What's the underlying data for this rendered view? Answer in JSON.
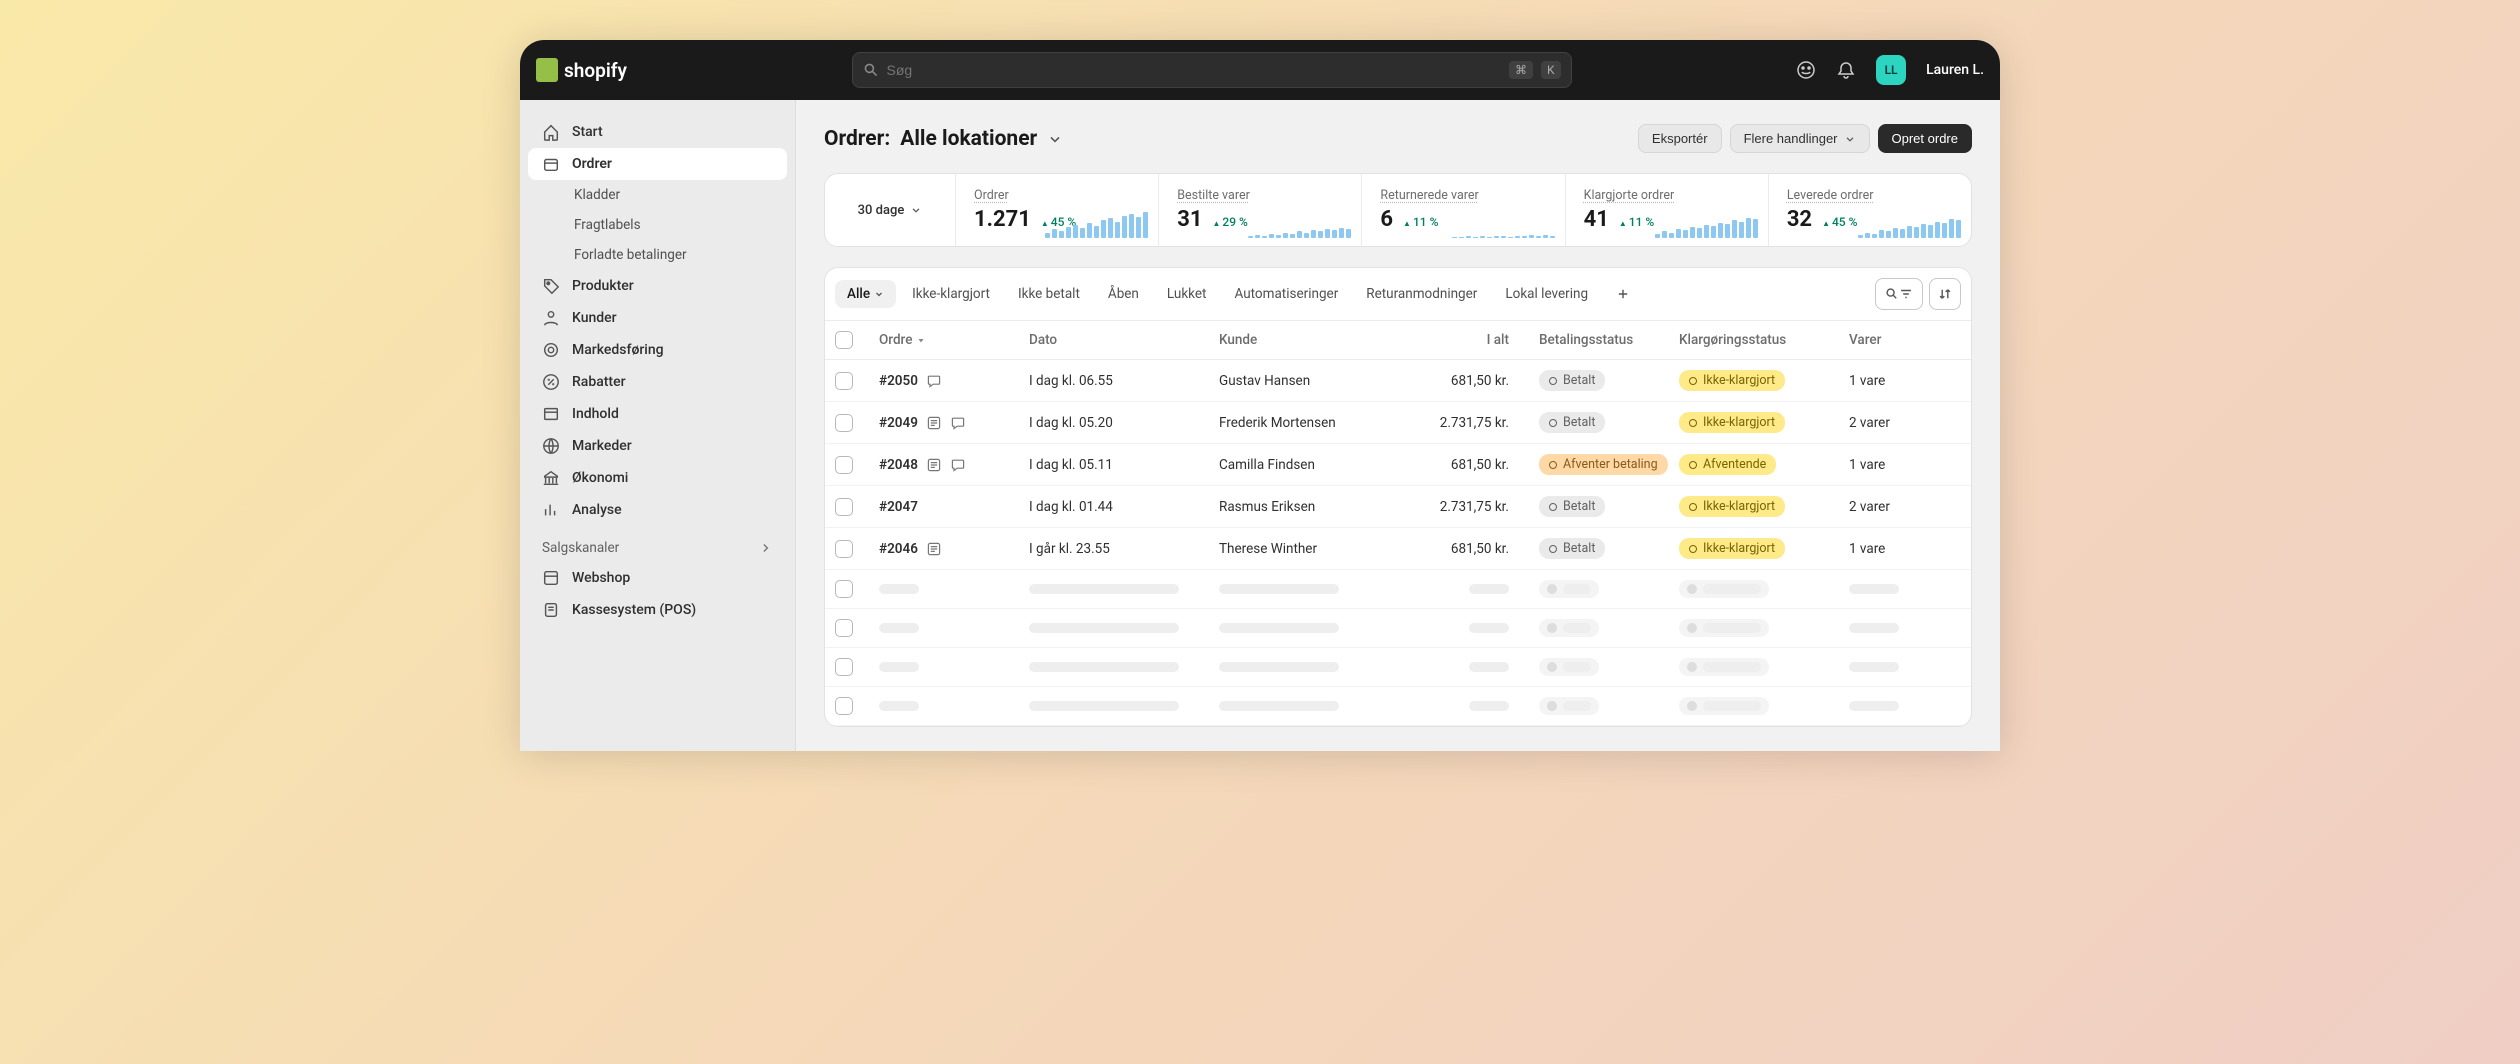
{
  "header": {
    "brand": "shopify",
    "search_placeholder": "Søg",
    "kbd1": "⌘",
    "kbd2": "K",
    "user_initials": "LL",
    "user_name": "Lauren L."
  },
  "sidebar": {
    "items": [
      {
        "label": "Start",
        "icon": "home"
      },
      {
        "label": "Ordrer",
        "icon": "orders",
        "active": true
      },
      {
        "label": "Kladder",
        "sub": true
      },
      {
        "label": "Fragtlabels",
        "sub": true
      },
      {
        "label": "Forladte betalinger",
        "sub": true
      },
      {
        "label": "Produkter",
        "icon": "tag"
      },
      {
        "label": "Kunder",
        "icon": "person"
      },
      {
        "label": "Markedsføring",
        "icon": "target"
      },
      {
        "label": "Rabatter",
        "icon": "discount"
      },
      {
        "label": "Indhold",
        "icon": "content"
      },
      {
        "label": "Markeder",
        "icon": "globe"
      },
      {
        "label": "Økonomi",
        "icon": "bank"
      },
      {
        "label": "Analyse",
        "icon": "analytics"
      }
    ],
    "section_label": "Salgskanaler",
    "channels": [
      {
        "label": "Webshop"
      },
      {
        "label": "Kassesystem (POS)"
      }
    ]
  },
  "page": {
    "title_prefix": "Ordrer:",
    "title_location": "Alle lokationer",
    "actions": {
      "export": "Eksportér",
      "more": "Flere handlinger",
      "create": "Opret ordre"
    }
  },
  "stats": {
    "range": "30 dage",
    "cards": [
      {
        "label": "Ordrer",
        "value": "1.271",
        "delta": "45 %"
      },
      {
        "label": "Bestilte varer",
        "value": "31",
        "delta": "29 %"
      },
      {
        "label": "Returnerede varer",
        "value": "6",
        "delta": "11 %"
      },
      {
        "label": "Klargjorte ordrer",
        "value": "41",
        "delta": "11 %"
      },
      {
        "label": "Leverede ordrer",
        "value": "32",
        "delta": "45 %"
      }
    ]
  },
  "tabs": [
    "Alle",
    "Ikke-klargjort",
    "Ikke betalt",
    "Åben",
    "Lukket",
    "Automatiseringer",
    "Returanmodninger",
    "Lokal levering"
  ],
  "columns": {
    "order": "Ordre",
    "date": "Dato",
    "customer": "Kunde",
    "total": "I alt",
    "payment": "Betalingsstatus",
    "fulfillment": "Klargøringsstatus",
    "items": "Varer"
  },
  "rows": [
    {
      "id": "#2050",
      "icons": [
        "chat"
      ],
      "date": "I dag kl. 06.55",
      "customer": "Gustav Hansen",
      "total": "681,50 kr.",
      "payment": "Betalt",
      "payClass": "b-paid",
      "fulfill": "Ikke-klargjort",
      "fulClass": "b-unfulfilled",
      "items": "1 vare"
    },
    {
      "id": "#2049",
      "icons": [
        "note",
        "chat"
      ],
      "date": "I dag kl. 05.20",
      "customer": "Frederik Mortensen",
      "total": "2.731,75 kr.",
      "payment": "Betalt",
      "payClass": "b-paid",
      "fulfill": "Ikke-klargjort",
      "fulClass": "b-unfulfilled",
      "items": "2 varer"
    },
    {
      "id": "#2048",
      "icons": [
        "note",
        "chat"
      ],
      "date": "I dag kl. 05.11",
      "customer": "Camilla Findsen",
      "total": "681,50 kr.",
      "payment": "Afventer betaling",
      "payClass": "b-pending-pay",
      "fulfill": "Afventende",
      "fulClass": "b-pending",
      "items": "1 vare"
    },
    {
      "id": "#2047",
      "icons": [],
      "date": "I dag kl. 01.44",
      "customer": "Rasmus Eriksen",
      "total": "2.731,75 kr.",
      "payment": "Betalt",
      "payClass": "b-paid",
      "fulfill": "Ikke-klargjort",
      "fulClass": "b-unfulfilled",
      "items": "2 varer"
    },
    {
      "id": "#2046",
      "icons": [
        "note"
      ],
      "date": "I går kl. 23.55",
      "customer": "Therese Winther",
      "total": "681,50 kr.",
      "payment": "Betalt",
      "payClass": "b-paid",
      "fulfill": "Ikke-klargjort",
      "fulClass": "b-unfulfilled",
      "items": "1 vare"
    }
  ]
}
